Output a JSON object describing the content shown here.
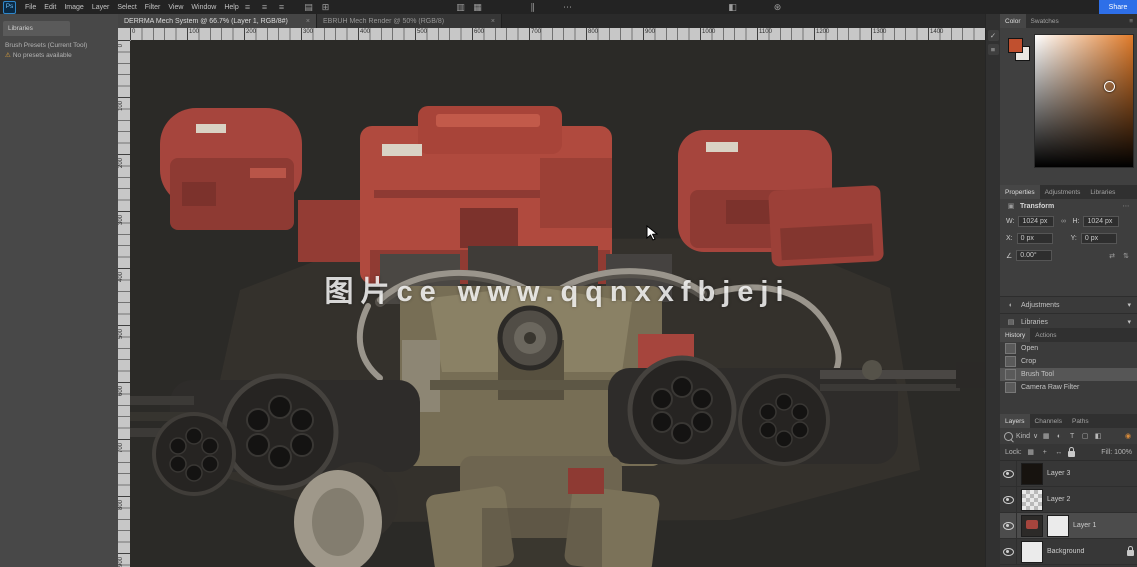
{
  "menubar": {
    "app_badge": "Ps",
    "menus": [
      "File",
      "Edit",
      "Image",
      "Layer",
      "Select",
      "Filter",
      "View",
      "Window",
      "Help"
    ],
    "icons": [
      "≡",
      "≡",
      "≡",
      "▤",
      "⊞",
      "▥",
      "▦",
      "∥",
      "⋯",
      "◧",
      "⊛"
    ],
    "share_label": "Share"
  },
  "doc_tabs": [
    {
      "label": "DERRMA Mech System @ 66.7% (Layer 1, RGB/8#)",
      "close": "×"
    },
    {
      "label": "EBRUH Mech Render @ 50% (RGB/8)",
      "close": "×"
    }
  ],
  "left_panel": {
    "tab": "Libraries",
    "line1": "Brush Presets (Current Tool)",
    "warn_icon": "⚠",
    "line2": "No presets available"
  },
  "rulers": {
    "top": [
      "0",
      "100",
      "200",
      "300",
      "400",
      "500",
      "600",
      "700",
      "800",
      "900",
      "1000",
      "1100",
      "1200",
      "1300",
      "1400"
    ],
    "left": [
      "0",
      "100",
      "200",
      "300",
      "400",
      "500",
      "600",
      "700",
      "800",
      "900"
    ]
  },
  "canvas": {
    "watermark": "图片ce www.qqnxxfbjeji"
  },
  "right_strip": {
    "icons": [
      "✓",
      "≡"
    ]
  },
  "color_panel": {
    "tabs": [
      "Color",
      "Swatches"
    ],
    "menu_icon": "≡",
    "fg_color": "#c0502f",
    "bg_color": "#e9e7e2",
    "gradient_right": "#e07b2a"
  },
  "properties_panel": {
    "tabs": [
      "Properties",
      "Adjustments",
      "Libraries"
    ],
    "section_icon": "▣",
    "section_title": "Transform",
    "menu_icon": "⋯",
    "w_label": "W:",
    "w_value": "1024 px",
    "link_icon": "∞",
    "h_label": "H:",
    "h_value": "1024 px",
    "x_label": "X:",
    "x_value": "0 px",
    "y_label": "Y:",
    "y_value": "0 px",
    "angle_label": "∠",
    "angle_value": "0.00°",
    "flip_h_icon": "⇄",
    "flip_v_icon": "⇅"
  },
  "quick_rows": [
    {
      "icon": "◐",
      "label": "Adjustments",
      "chevron": "▾"
    },
    {
      "icon": "▤",
      "label": "Libraries",
      "chevron": "▾"
    }
  ],
  "history_panel": {
    "tabs": [
      "History",
      "Actions"
    ],
    "rows": [
      {
        "label": "Open"
      },
      {
        "label": "Crop"
      },
      {
        "label": "Brush Tool"
      },
      {
        "label": "Camera Raw Filter"
      }
    ]
  },
  "layers_panel": {
    "tabs": [
      "Layers",
      "Channels",
      "Paths"
    ],
    "filter_label": "Kind",
    "filter_chevron": "∨",
    "filter_icons": [
      "▦",
      "◐",
      "T",
      "▢",
      "◧"
    ],
    "accent_icon": "◉",
    "lock_label": "Lock:",
    "lock_icons": [
      "▦",
      "+",
      "↔"
    ],
    "fill_label": "Fill: 100%",
    "layers": [
      {
        "name": "Layer 3"
      },
      {
        "name": "Layer 2"
      },
      {
        "name": "Layer 1"
      },
      {
        "name": "Background"
      }
    ]
  }
}
